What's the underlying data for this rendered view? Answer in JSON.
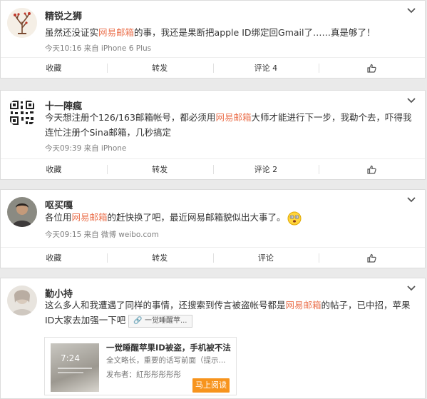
{
  "colors": {
    "highlight": "#eb7350",
    "read_button": "#f7941d"
  },
  "posts": [
    {
      "author": "精锐之狮",
      "avatar_icon": "tree-avatar-icon",
      "text": {
        "before": "虽然还没证实",
        "highlight": "网易邮箱",
        "after": "的事，我还是果断把apple ID绑定回Gmail了……真是够了！"
      },
      "meta": "今天10:16 来自 iPhone 6 Plus",
      "actions": {
        "favorite": "收藏",
        "repost": "转发",
        "comment": "评论 4"
      }
    },
    {
      "author": "十一陣瘋",
      "avatar_icon": "qr-code-avatar-icon",
      "text": {
        "before": "今天想注册个126/163邮箱帐号，都必须用",
        "highlight": "网易邮箱",
        "after": "大师才能进行下一步，我勒个去，吓得我连忙注册个Sina邮箱，几秒搞定"
      },
      "meta": "今天09:39 来自 iPhone",
      "actions": {
        "favorite": "收藏",
        "repost": "转发",
        "comment": "评论 2"
      }
    },
    {
      "author": "呕买嘎",
      "avatar_icon": "person-avatar-icon",
      "text": {
        "before": "各位用",
        "highlight": "网易邮箱",
        "after": "的赶快换了吧，最近网易邮箱貌似出大事了。"
      },
      "meta": "今天09:15 来自 微博 weibo.com",
      "actions": {
        "favorite": "收藏",
        "repost": "转发",
        "comment": "评论"
      }
    },
    {
      "author": "勤小持",
      "avatar_icon": "blurry-person-avatar-icon",
      "text": {
        "before": "这么多人和我遭遇了同样的事情，还搜索到传言被盗帐号都是",
        "highlight": "网易邮箱",
        "after": "的帖子，已中招，苹果ID大家去加强一下吧"
      },
      "tag": "一觉睡醒苹...",
      "article": {
        "title": "一觉睡醒苹果ID被盗，手机被不法...",
        "summary": "全文略长，重要的话写前面（提示...",
        "publisher": "发布者：紅彤彤彤彤彤",
        "button": "马上阅读",
        "thumb_time": "7:24"
      }
    }
  ]
}
